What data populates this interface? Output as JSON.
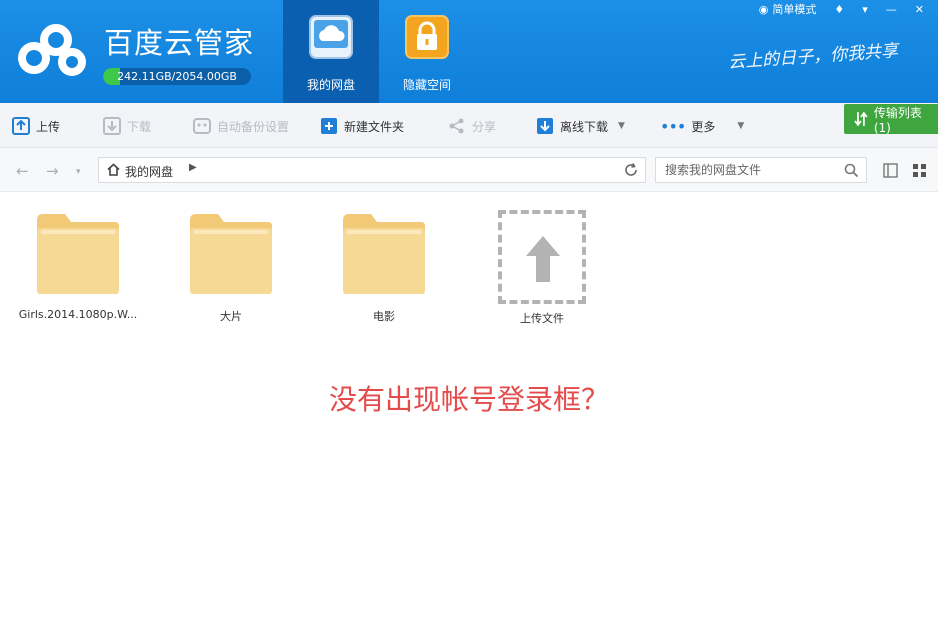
{
  "app": {
    "title": "百度云管家",
    "quota_text": "242.11GB/2054.00GB",
    "quota_fraction": 0.118
  },
  "nav_tabs": [
    {
      "label": "我的网盘",
      "icon": "cloud-drive-icon",
      "active": true
    },
    {
      "label": "隐藏空间",
      "icon": "lock-icon",
      "active": false
    }
  ],
  "top_links": {
    "simple_mode": "简单模式"
  },
  "slogan": "云上的日子，你我共享",
  "toolbar": {
    "upload": "上传",
    "download": "下载",
    "auto_backup": "自动备份设置",
    "new_folder": "新建文件夹",
    "share": "分享",
    "offline_download": "离线下载",
    "more": "更多",
    "transfer_list": "传输列表(1)"
  },
  "address": {
    "path": "我的网盘",
    "search_placeholder": "搜索我的网盘文件"
  },
  "files": [
    {
      "name": "Girls.2014.1080p.W...",
      "type": "folder"
    },
    {
      "name": "大片",
      "type": "folder"
    },
    {
      "name": "电影",
      "type": "folder"
    },
    {
      "name": "上传文件",
      "type": "upload"
    }
  ],
  "annotation": "没有出现帐号登录框？",
  "colors": {
    "header_blue": "#1c8fe6",
    "active_tab": "#0a5fb0",
    "folder": "#f5d690",
    "transfer_green": "#3fa63f",
    "annotation_red": "#e54b4b"
  }
}
